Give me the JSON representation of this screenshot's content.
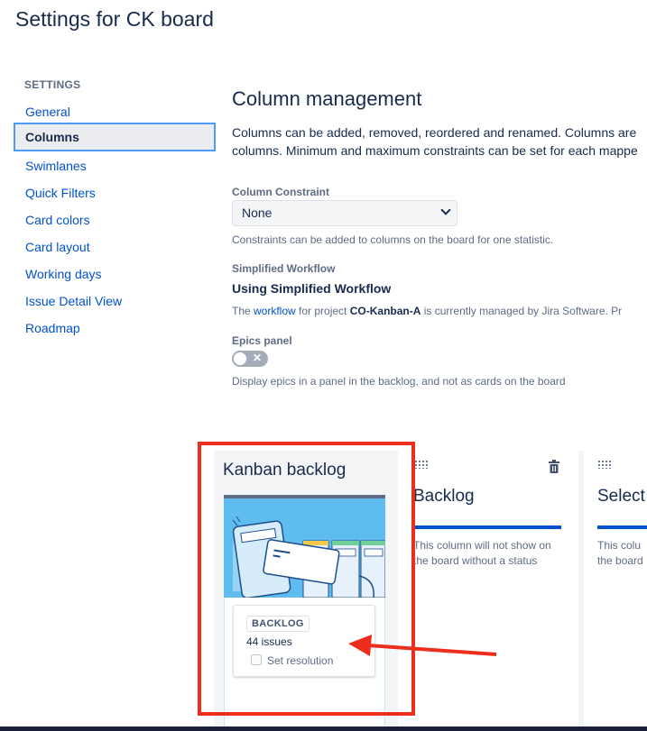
{
  "page": {
    "title": "Settings for CK board"
  },
  "sidebar": {
    "heading": "SETTINGS",
    "items": [
      {
        "label": "General"
      },
      {
        "label": "Columns",
        "active": true
      },
      {
        "label": "Swimlanes"
      },
      {
        "label": "Quick Filters"
      },
      {
        "label": "Card colors"
      },
      {
        "label": "Card layout"
      },
      {
        "label": "Working days"
      },
      {
        "label": "Issue Detail View"
      },
      {
        "label": "Roadmap"
      }
    ]
  },
  "main": {
    "title": "Column management",
    "description_line1": "Columns can be added, removed, reordered and renamed. Columns are",
    "description_line2": "columns. Minimum and maximum constraints can be set for each mappe",
    "constraint": {
      "label": "Column Constraint",
      "value": "None",
      "help": "Constraints can be added to columns on the board for one statistic."
    },
    "workflow": {
      "label": "Simplified Workflow",
      "heading": "Using Simplified Workflow",
      "text_before": "The ",
      "link": "workflow",
      "text_middle": " for project ",
      "project": "CO-Kanban-A",
      "text_after": " is currently managed by Jira Software. Pr"
    },
    "epics": {
      "label": "Epics panel",
      "toggle_on": false,
      "toggle_glyph": "✕",
      "help": "Display epics in a panel in the backlog, and not as cards on the board"
    }
  },
  "columns": [
    {
      "title": "Kanban backlog",
      "status_lozenge": "BACKLOG",
      "issues": "44 issues",
      "set_resolution": "Set resolution"
    },
    {
      "title": "Backlog",
      "note_line1": "This column will not show on",
      "note_line2": "the board without a status"
    },
    {
      "title": "Select",
      "note_line1": "This colu",
      "note_line2": "the board"
    }
  ],
  "colors": {
    "accent": "#0052cc",
    "highlight_box": "#ee2e1c",
    "illustration_bg": "#5fbcee"
  }
}
